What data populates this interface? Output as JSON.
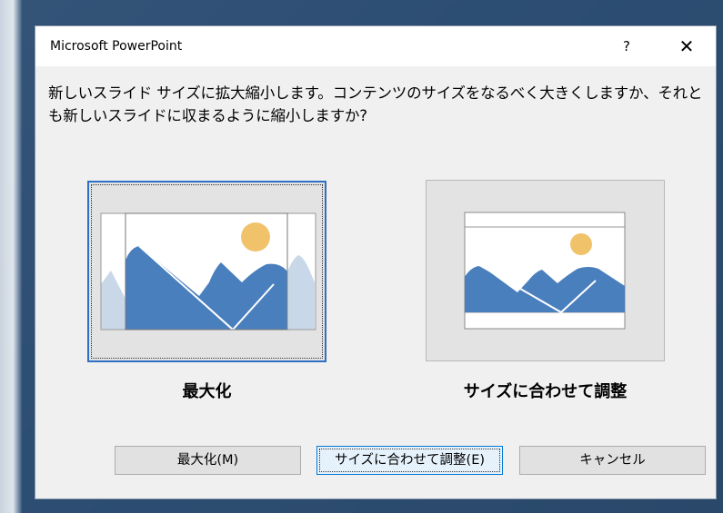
{
  "dialog": {
    "title": "Microsoft PowerPoint",
    "help_label": "?",
    "close_label": "✕",
    "message": "新しいスライド サイズに拡大縮小します。コンテンツのサイズをなるべく大きくしますか、それとも新しいスライドに収まるように縮小しますか?"
  },
  "options": {
    "maximize_label": "最大化",
    "fit_label": "サイズに合わせて調整"
  },
  "buttons": {
    "maximize": "最大化(M)",
    "fit": "サイズに合わせて調整(E)",
    "cancel": "キャンセル"
  },
  "colors": {
    "accent": "#2f6fc4",
    "mountain": "#4a7fbe",
    "mountain_faded": "#c9d8e9",
    "sun": "#f0c36b"
  }
}
